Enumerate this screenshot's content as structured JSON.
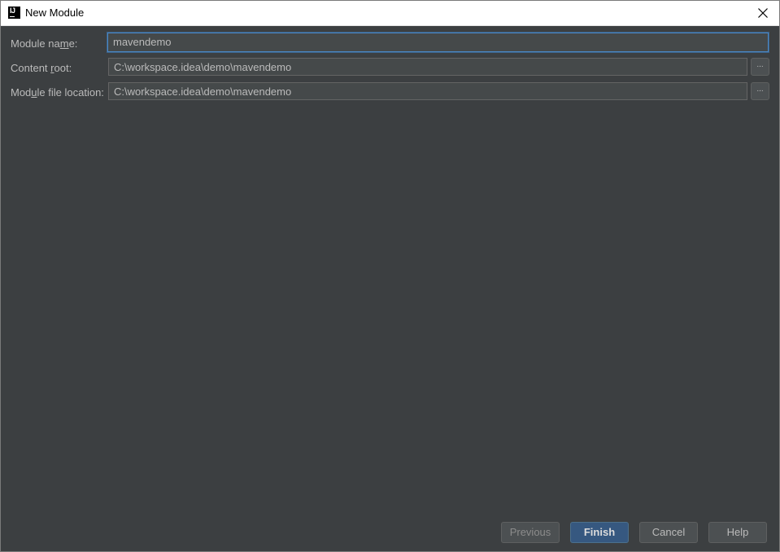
{
  "window": {
    "title": "New Module",
    "app_icon": "intellij-icon",
    "app_icon_glyph": "IJ"
  },
  "form": {
    "module_name": {
      "label_pre": "Module na",
      "label_mnemonic": "m",
      "label_post": "e:",
      "value": "mavendemo"
    },
    "content_root": {
      "label_pre": "Content ",
      "label_mnemonic": "r",
      "label_post": "oot:",
      "value": "C:\\workspace.idea\\demo\\mavendemo",
      "browse_label": "..."
    },
    "module_file_location": {
      "label_pre": "Mod",
      "label_mnemonic": "u",
      "label_post": "le file location:",
      "value": "C:\\workspace.idea\\demo\\mavendemo",
      "browse_label": "..."
    }
  },
  "footer": {
    "previous_label": "Previous",
    "finish_label": "Finish",
    "cancel_label": "Cancel",
    "help_label": "Help"
  },
  "colors": {
    "background": "#3c3f41",
    "field_background": "#45494a",
    "text": "#bbbbbb",
    "focus_border": "#4a88c7",
    "primary_button": "#365880"
  }
}
